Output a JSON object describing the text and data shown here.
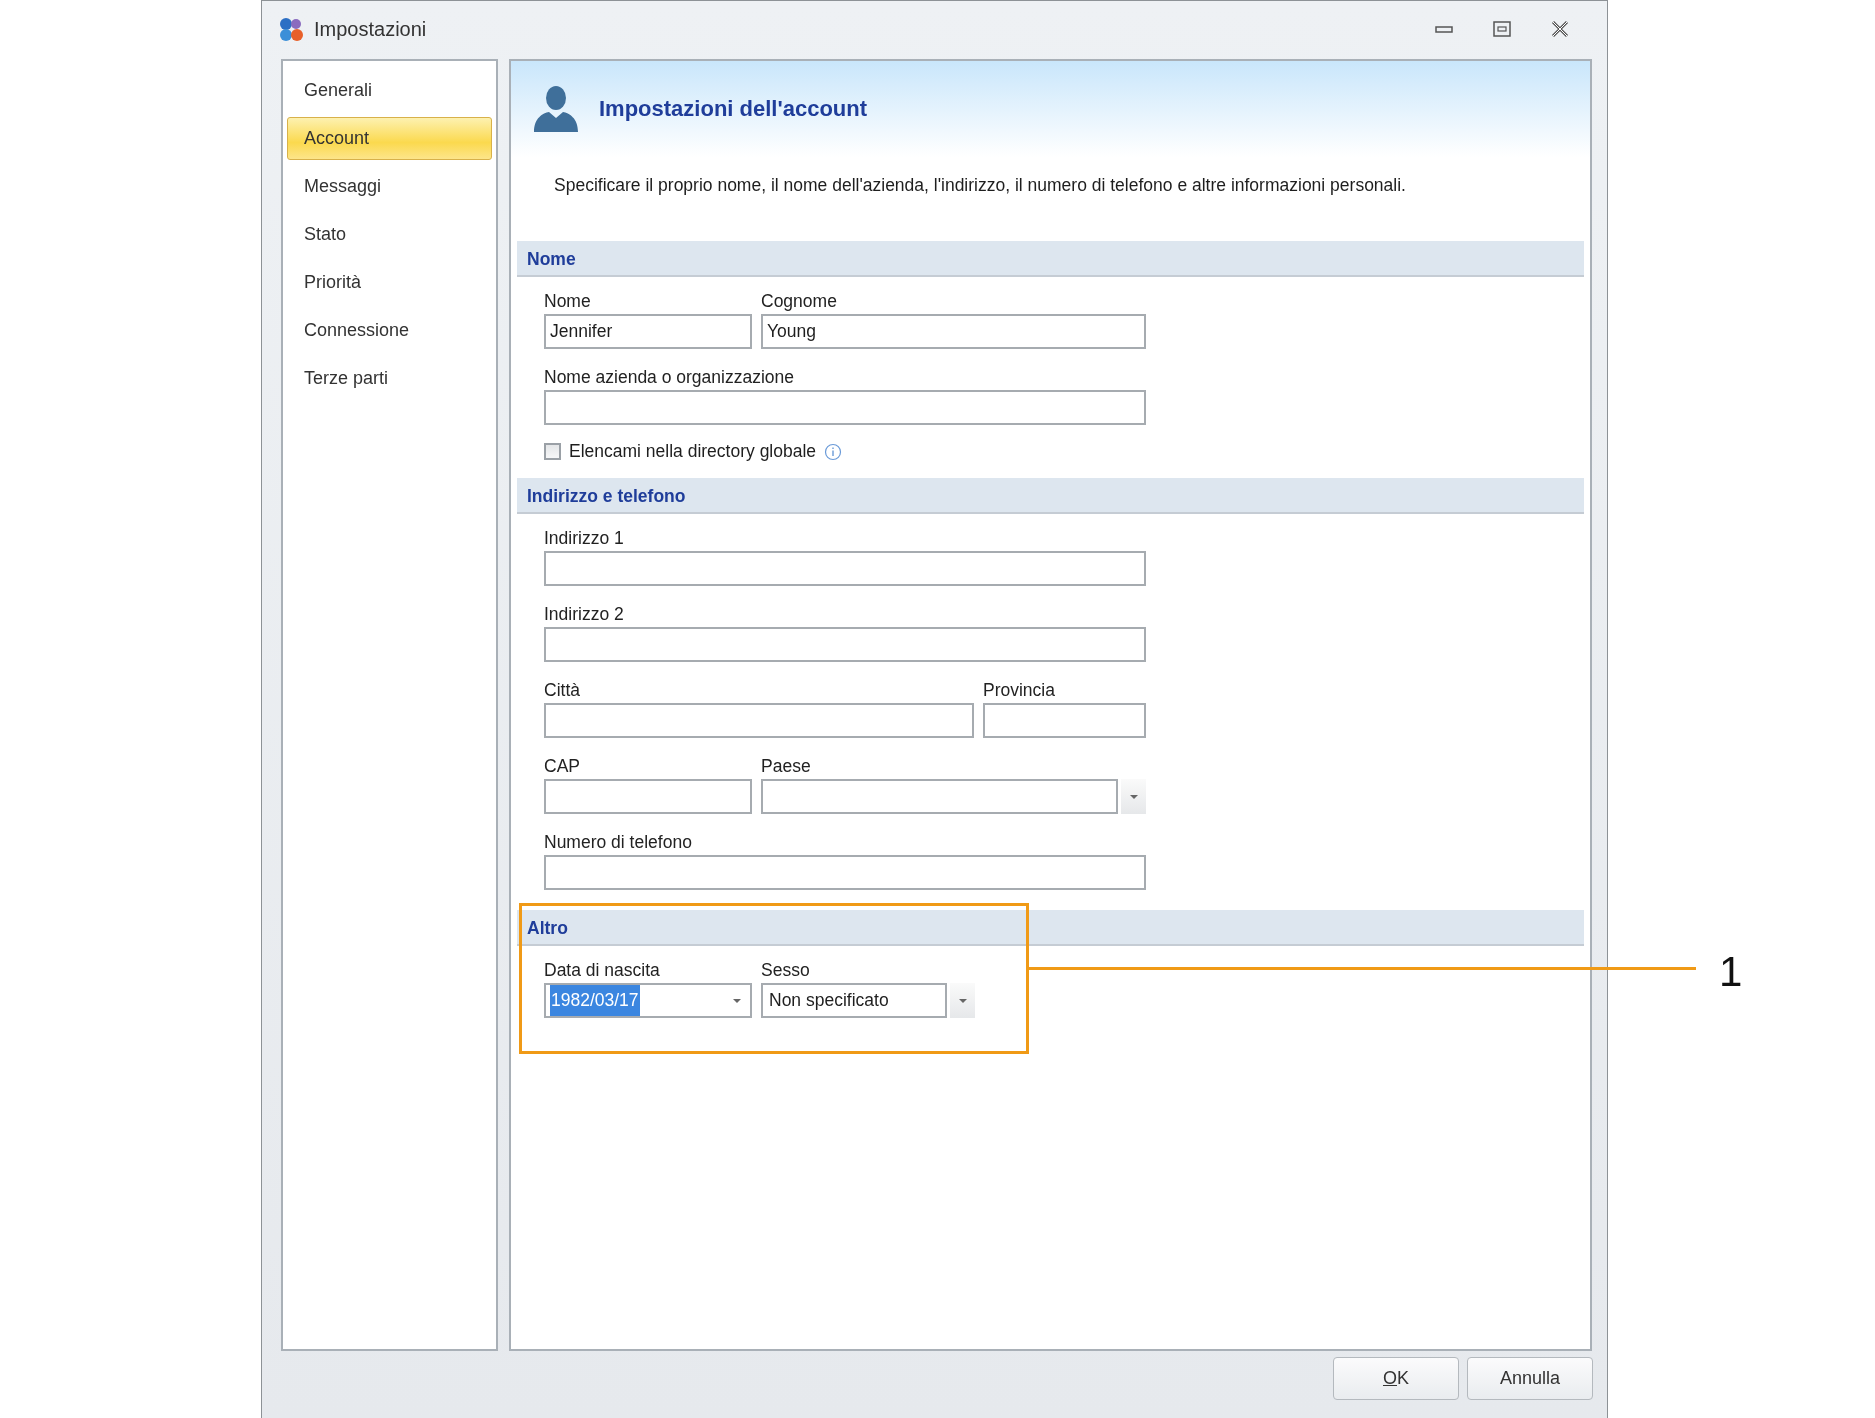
{
  "window": {
    "title": "Impostazioni"
  },
  "sidebar": {
    "items": [
      {
        "label": "Generali",
        "selected": false
      },
      {
        "label": "Account",
        "selected": true
      },
      {
        "label": "Messaggi",
        "selected": false
      },
      {
        "label": "Stato",
        "selected": false
      },
      {
        "label": "Priorità",
        "selected": false
      },
      {
        "label": "Connessione",
        "selected": false
      },
      {
        "label": "Terze parti",
        "selected": false
      }
    ]
  },
  "header": {
    "title": "Impostazioni dell'account",
    "description": "Specificare il proprio nome, il nome dell'azienda, l'indirizzo, il numero di telefono e altre informazioni personali."
  },
  "sections": [
    {
      "title": "Nome",
      "rows": [
        [
          {
            "kind": "text",
            "label": "Nome",
            "value": "Jennifer"
          },
          {
            "kind": "text",
            "label": "Cognome",
            "value": "Young"
          }
        ],
        [
          {
            "kind": "text",
            "label": "Nome azienda o organizzazione"
          }
        ],
        [
          {
            "kind": "checkbox",
            "label": "Elencami nella directory globale",
            "checked": false,
            "info": true
          }
        ]
      ]
    },
    {
      "title": "Indirizzo e telefono",
      "rows": [
        [
          {
            "kind": "text",
            "label": "Indirizzo 1"
          }
        ],
        [
          {
            "kind": "text",
            "label": "Indirizzo 2"
          }
        ],
        [
          {
            "kind": "text",
            "label": "Città"
          },
          {
            "kind": "text",
            "label": "Provincia"
          }
        ],
        [
          {
            "kind": "text",
            "label": "CAP"
          },
          {
            "kind": "dropdown",
            "label": "Paese"
          }
        ],
        [
          {
            "kind": "text",
            "label": "Numero di telefono"
          }
        ]
      ]
    },
    {
      "title": "Altro",
      "callout": "1",
      "rows": [
        [
          {
            "kind": "date",
            "label": "Data di nascita",
            "value": "1982/03/17",
            "text_selected": true
          },
          {
            "kind": "dropdown",
            "label": "Sesso",
            "value": "Non specificato"
          }
        ]
      ]
    }
  ],
  "buttons": [
    {
      "label": "OK",
      "first_letter_underlined": true
    },
    {
      "label": "Annulla"
    }
  ]
}
